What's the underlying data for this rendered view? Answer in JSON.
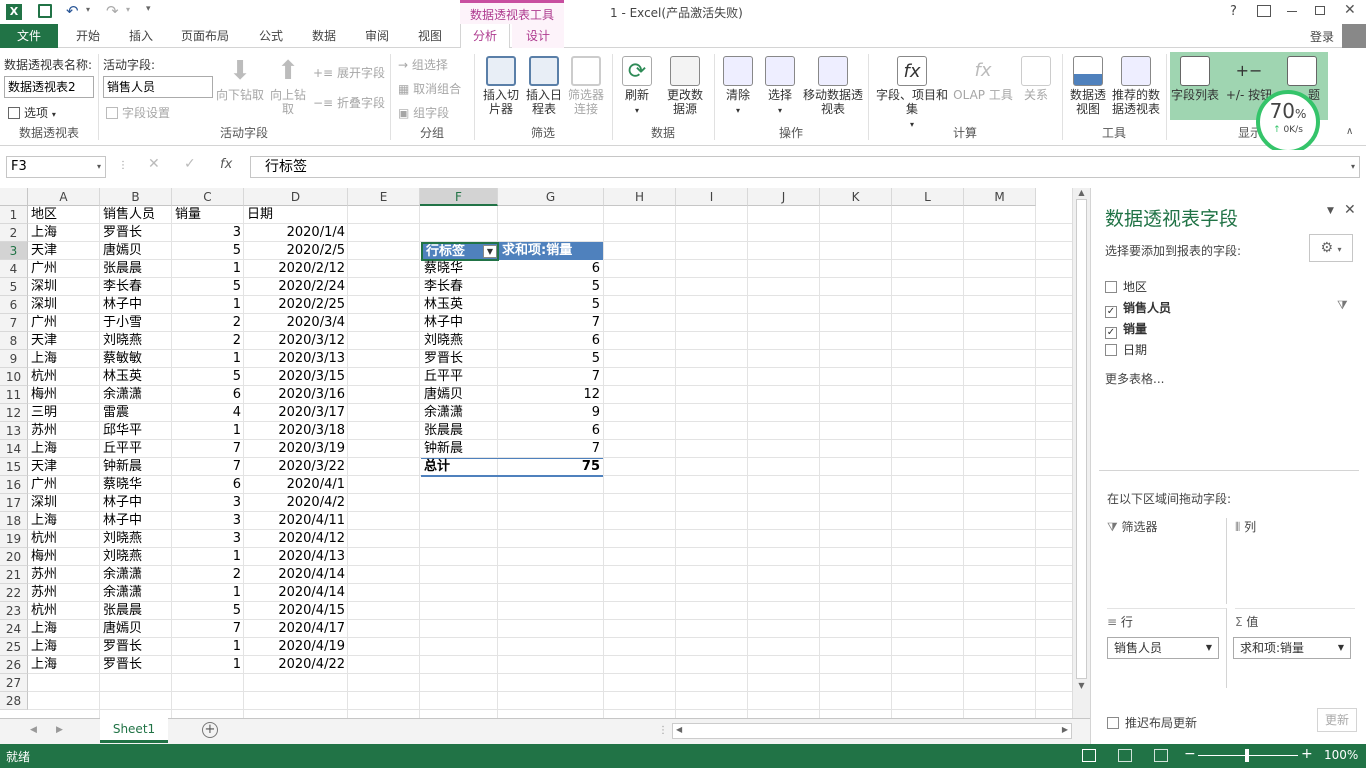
{
  "window": {
    "title": "1 - Excel(产品激活失败)",
    "context_tab_group": "数据透视表工具",
    "help_label": "?",
    "signin_label": "登录"
  },
  "ribbon_tabs": [
    "文件",
    "开始",
    "插入",
    "页面布局",
    "公式",
    "数据",
    "审阅",
    "视图",
    "分析",
    "设计"
  ],
  "ribbon": {
    "pivot_name_label": "数据透视表名称:",
    "pivot_name_value": "数据透视表2",
    "options_label": "选项",
    "group_pivot": "数据透视表",
    "active_field_label": "活动字段:",
    "active_field_value": "销售人员",
    "field_settings": "字段设置",
    "drill_down": "向下钻取",
    "drill_up": "向上钻取",
    "expand_field": "展开字段",
    "collapse_field": "折叠字段",
    "group_active_field": "活动字段",
    "group_selection": "组选择",
    "ungroup": "取消组合",
    "group_field": "组字段",
    "group_group": "分组",
    "insert_slicer": "插入切片器",
    "insert_timeline": "插入日程表",
    "filter_connections": "筛选器连接",
    "group_filter": "筛选",
    "refresh": "刷新",
    "change_source": "更改数据源",
    "group_data": "数据",
    "clear": "清除",
    "select": "选择",
    "move_pivot": "移动数据透视表",
    "group_actions": "操作",
    "fields_items_sets": "字段、项目和集",
    "olap_tools": "OLAP 工具",
    "relationships": "关系",
    "group_calc": "计算",
    "pivot_chart": "数据透视图",
    "recommended_pivot": "推荐的数据透视表",
    "group_tools": "工具",
    "field_list": "字段列表",
    "buttons_toggle": "+/- 按钮",
    "field_headers_partial": "题",
    "group_show_partial": "显示"
  },
  "net_widget": {
    "percent": "70",
    "percent_sign": "%",
    "speed": "0K/s"
  },
  "formula_bar": {
    "name_box": "F3",
    "fx": "fx",
    "content": "行标签"
  },
  "columns": [
    "A",
    "B",
    "C",
    "D",
    "E",
    "F",
    "G",
    "H",
    "I",
    "J",
    "K",
    "L",
    "M"
  ],
  "rows": [
    "1",
    "2",
    "3",
    "4",
    "5",
    "6",
    "7",
    "8",
    "9",
    "10",
    "11",
    "12",
    "13",
    "14",
    "15",
    "16",
    "17",
    "18",
    "19",
    "20",
    "21",
    "22",
    "23",
    "24",
    "25",
    "26",
    "27",
    "28"
  ],
  "source_table": {
    "headers": [
      "地区",
      "销售人员",
      "销量",
      "日期"
    ],
    "rows": [
      [
        "上海",
        "罗晋长",
        "3",
        "2020/1/4"
      ],
      [
        "天津",
        "唐嫣贝",
        "5",
        "2020/2/5"
      ],
      [
        "广州",
        "张晨晨",
        "1",
        "2020/2/12"
      ],
      [
        "深圳",
        "李长春",
        "5",
        "2020/2/24"
      ],
      [
        "深圳",
        "林子中",
        "1",
        "2020/2/25"
      ],
      [
        "广州",
        "于小雪",
        "2",
        "2020/3/4"
      ],
      [
        "天津",
        "刘晓燕",
        "2",
        "2020/3/12"
      ],
      [
        "上海",
        "蔡敏敏",
        "1",
        "2020/3/13"
      ],
      [
        "杭州",
        "林玉英",
        "5",
        "2020/3/15"
      ],
      [
        "梅州",
        "余潇潇",
        "6",
        "2020/3/16"
      ],
      [
        "三明",
        "雷震",
        "4",
        "2020/3/17"
      ],
      [
        "苏州",
        "邱华平",
        "1",
        "2020/3/18"
      ],
      [
        "上海",
        "丘平平",
        "7",
        "2020/3/19"
      ],
      [
        "天津",
        "钟新晨",
        "7",
        "2020/3/22"
      ],
      [
        "广州",
        "蔡晓华",
        "6",
        "2020/4/1"
      ],
      [
        "深圳",
        "林子中",
        "3",
        "2020/4/2"
      ],
      [
        "上海",
        "林子中",
        "3",
        "2020/4/11"
      ],
      [
        "杭州",
        "刘晓燕",
        "3",
        "2020/4/12"
      ],
      [
        "梅州",
        "刘晓燕",
        "1",
        "2020/4/13"
      ],
      [
        "苏州",
        "余潇潇",
        "2",
        "2020/4/14"
      ],
      [
        "苏州",
        "余潇潇",
        "1",
        "2020/4/14"
      ],
      [
        "杭州",
        "张晨晨",
        "5",
        "2020/4/15"
      ],
      [
        "上海",
        "唐嫣贝",
        "7",
        "2020/4/17"
      ],
      [
        "上海",
        "罗晋长",
        "1",
        "2020/4/19"
      ],
      [
        "上海",
        "罗晋长",
        "1",
        "2020/4/22"
      ]
    ]
  },
  "pivot": {
    "header_label": "行标签",
    "header_value": "求和项:销量",
    "rows": [
      [
        "蔡晓华",
        "6"
      ],
      [
        "李长春",
        "5"
      ],
      [
        "林玉英",
        "5"
      ],
      [
        "林子中",
        "7"
      ],
      [
        "刘晓燕",
        "6"
      ],
      [
        "罗晋长",
        "5"
      ],
      [
        "丘平平",
        "7"
      ],
      [
        "唐嫣贝",
        "12"
      ],
      [
        "余潇潇",
        "9"
      ],
      [
        "张晨晨",
        "6"
      ],
      [
        "钟新晨",
        "7"
      ]
    ],
    "total_label": "总计",
    "total_value": "75"
  },
  "field_pane": {
    "title": "数据透视表字段",
    "subtitle": "选择要添加到报表的字段:",
    "fields": [
      {
        "name": "地区",
        "checked": false
      },
      {
        "name": "销售人员",
        "checked": true
      },
      {
        "name": "销量",
        "checked": true
      },
      {
        "name": "日期",
        "checked": false
      }
    ],
    "more_tables": "更多表格...",
    "drag_label": "在以下区域间拖动字段:",
    "area_filters": "筛选器",
    "area_columns": "列",
    "area_rows": "行",
    "area_values": "值",
    "rows_field": "销售人员",
    "values_field": "求和项:销量",
    "defer_update": "推迟布局更新",
    "update_button": "更新"
  },
  "sheet_tabs": {
    "active": "Sheet1"
  },
  "status": {
    "ready": "就绪",
    "zoom": "100%"
  },
  "colors": {
    "excel_green": "#217346",
    "pivot_header": "#4f81bd",
    "context_tab": "#ae3b8f"
  }
}
